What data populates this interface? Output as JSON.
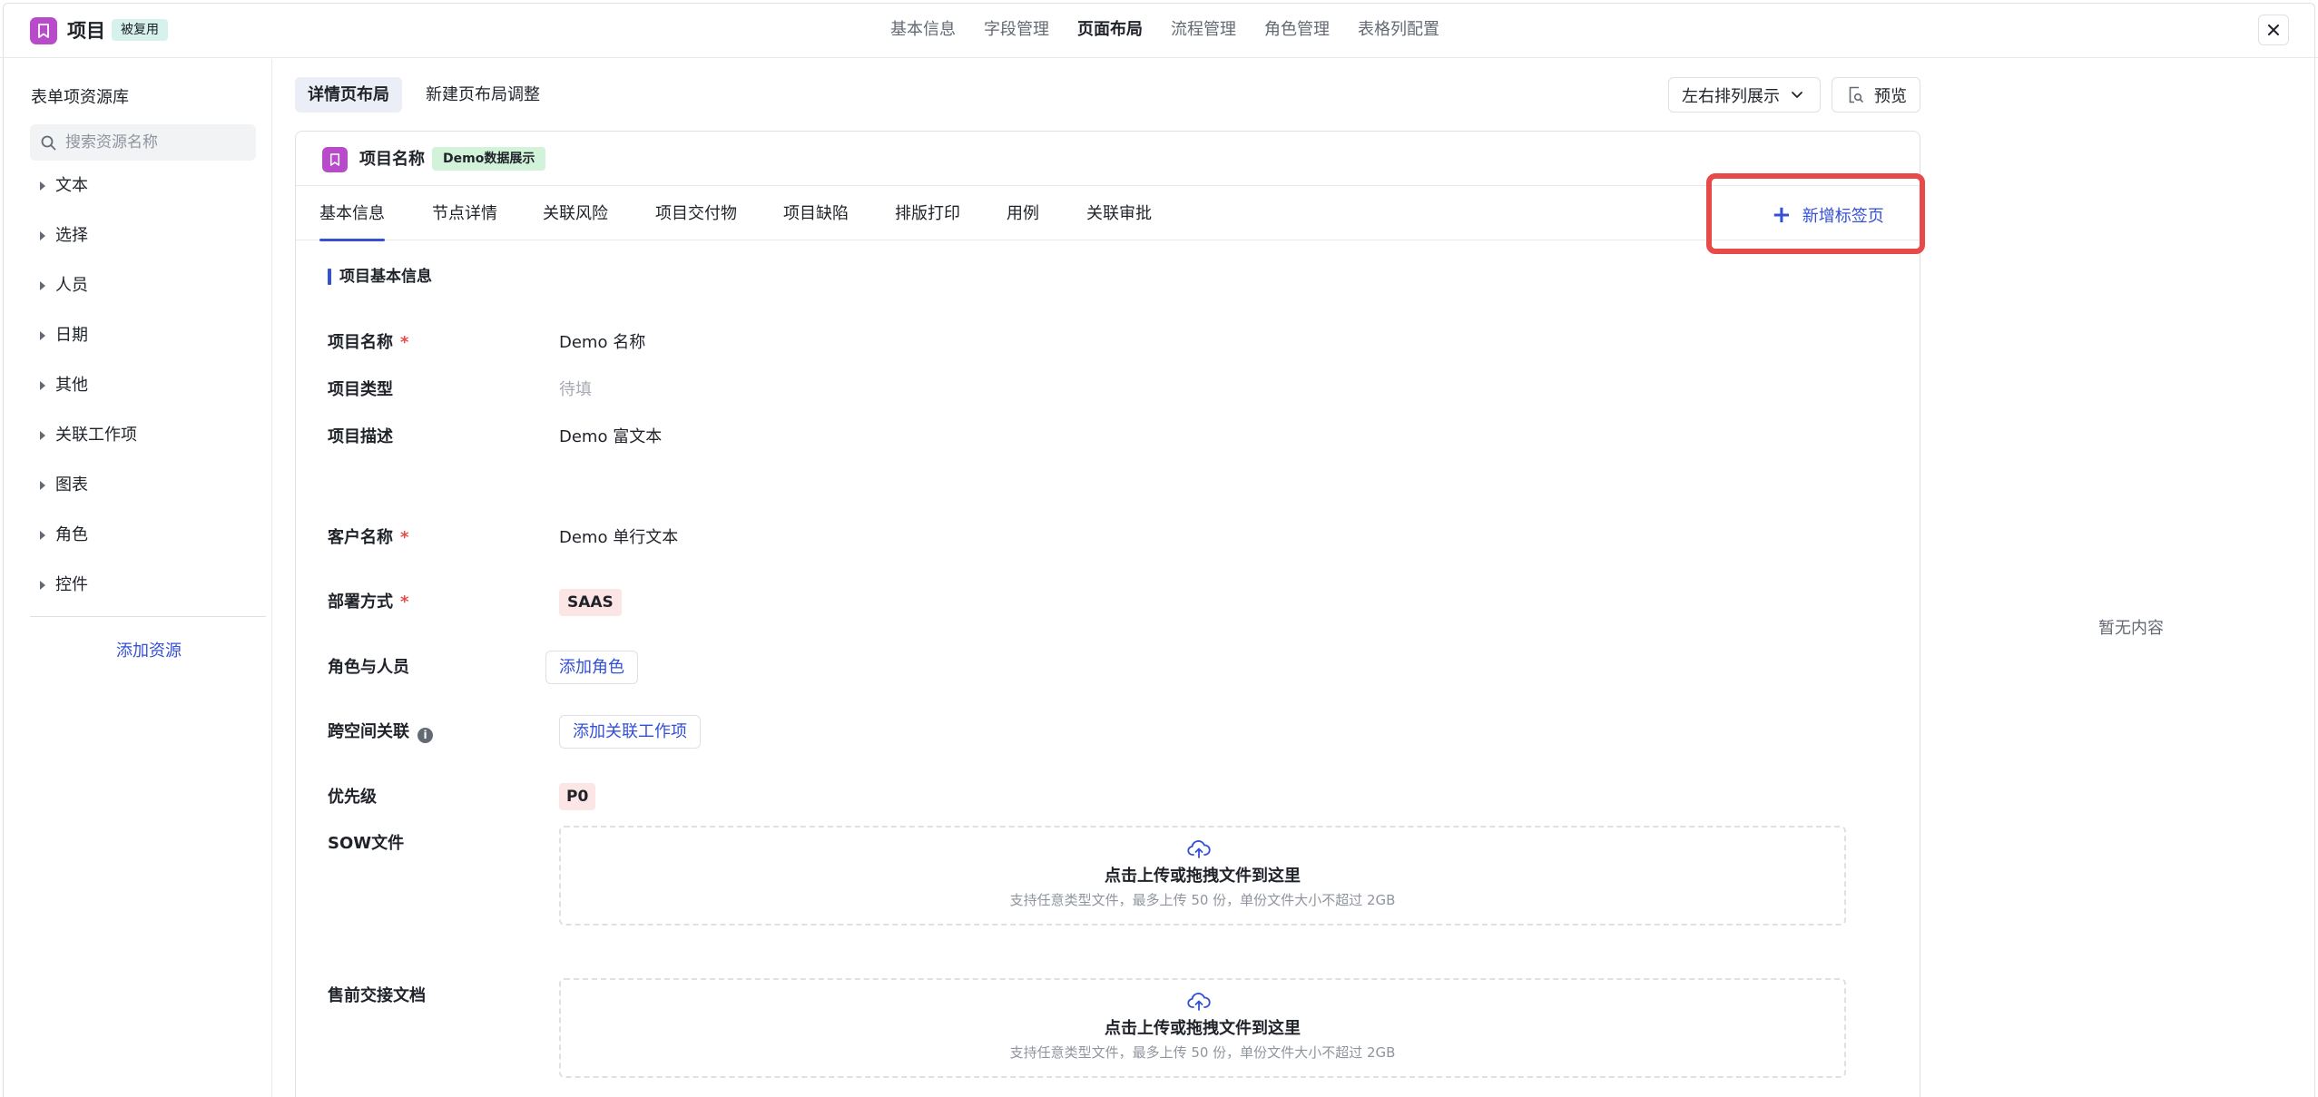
{
  "app": {
    "title": "项目",
    "badge": "被复用",
    "nav": [
      "基本信息",
      "字段管理",
      "页面布局",
      "流程管理",
      "角色管理",
      "表格列配置"
    ],
    "active_nav": "页面布局"
  },
  "sidebar": {
    "title": "表单项资源库",
    "search_placeholder": "搜索资源名称",
    "items": [
      "文本",
      "选择",
      "人员",
      "日期",
      "其他",
      "关联工作项",
      "图表",
      "角色",
      "控件"
    ],
    "add_label": "添加资源"
  },
  "layout_tabs": [
    "详情页布局",
    "新建页布局调整"
  ],
  "toolbar": {
    "arrange_label": "左右排列展示",
    "preview_label": "预览"
  },
  "card": {
    "title": "项目名称",
    "badge": "Demo数据展示",
    "tabs": [
      "基本信息",
      "节点详情",
      "关联风险",
      "项目交付物",
      "项目缺陷",
      "排版打印",
      "用例",
      "关联审批"
    ],
    "add_tab_label": "新增标签页",
    "section_title": "项目基本信息",
    "fields": {
      "name_label": "项目名称",
      "name_value": "Demo 名称",
      "type_label": "项目类型",
      "type_value": "待填",
      "desc_label": "项目描述",
      "desc_value": "Demo 富文本",
      "customer_label": "客户名称",
      "customer_value": "Demo 单行文本",
      "deploy_label": "部署方式",
      "deploy_value": "SAAS",
      "roles_label": "角色与人员",
      "roles_button": "添加角色",
      "cross_label": "跨空间关联",
      "cross_button": "添加关联工作项",
      "priority_label": "优先级",
      "priority_value": "P0",
      "sow_label": "SOW文件",
      "presale_label": "售前交接文档"
    },
    "required_mark": "*",
    "upload": {
      "main": "点击上传或拖拽文件到这里",
      "sub": "支持任意类型文件，最多上传 50 份，单份文件大小不超过 2GB"
    }
  },
  "right_panel": {
    "empty_text": "暂无内容"
  },
  "colors": {
    "accent": "#3350d6",
    "brand_logo": "#b84bc9",
    "highlight": "#e84a4a",
    "required": "#e84a4a"
  }
}
